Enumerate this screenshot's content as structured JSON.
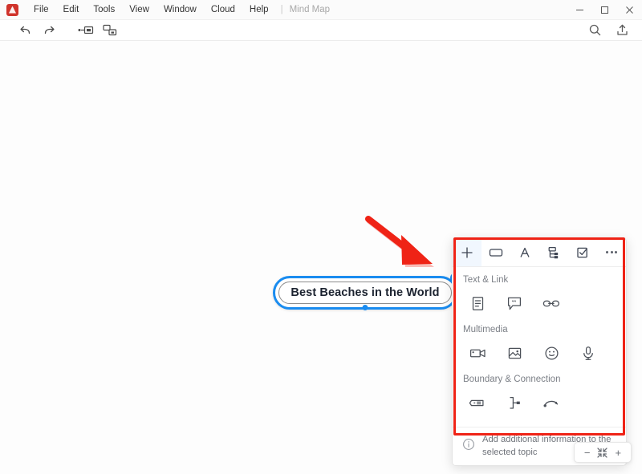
{
  "window": {
    "doc_name": "Mind Map",
    "menu_separator": "|",
    "menus": [
      {
        "label": "File",
        "name": "menu-file"
      },
      {
        "label": "Edit",
        "name": "menu-edit"
      },
      {
        "label": "Tools",
        "name": "menu-tools"
      },
      {
        "label": "View",
        "name": "menu-view"
      },
      {
        "label": "Window",
        "name": "menu-window"
      },
      {
        "label": "Cloud",
        "name": "menu-cloud"
      },
      {
        "label": "Help",
        "name": "menu-help"
      }
    ],
    "controls": {
      "minimize": "minimize-button",
      "maximize": "maximize-button",
      "close": "close-button"
    },
    "logo_icon": "app-logo-icon"
  },
  "toolbar": {
    "undo_icon": "undo-icon",
    "redo_icon": "redo-icon",
    "insert_topic_icon": "insert-topic-icon",
    "insert_subtopic_icon": "insert-subtopic-icon",
    "search_icon": "search-icon",
    "share_icon": "share-icon"
  },
  "mindmap": {
    "topic": {
      "text": "Best Beaches in the World",
      "selected": true,
      "selection_color": "#1a8cf0",
      "handle_bottom": "resize-handle-bottom",
      "handle_topright": "add-topic-handle"
    }
  },
  "panel": {
    "tabs": [
      {
        "label": "",
        "icon": "plus-icon",
        "name": "tab-insert",
        "active": true
      },
      {
        "label": "",
        "icon": "shape-icon",
        "name": "tab-shape",
        "active": false
      },
      {
        "label": "",
        "icon": "font-icon",
        "name": "tab-font",
        "active": false
      },
      {
        "label": "",
        "icon": "structure-icon",
        "name": "tab-structure",
        "active": false
      },
      {
        "label": "",
        "icon": "task-checkbox-icon",
        "name": "tab-task",
        "active": false
      },
      {
        "label": "",
        "icon": "more-options-icon",
        "name": "tab-more",
        "active": false
      }
    ],
    "sections": [
      {
        "title": "Text & Link",
        "name": "section-text-and-link",
        "items": [
          {
            "icon": "notes-icon",
            "name": "insert-notes-button"
          },
          {
            "icon": "comment-icon",
            "name": "insert-comment-button"
          },
          {
            "icon": "hyperlink-icon",
            "name": "insert-hyperlink-button"
          }
        ]
      },
      {
        "title": "Multimedia",
        "name": "section-multimedia",
        "items": [
          {
            "icon": "video-icon",
            "name": "insert-video-button"
          },
          {
            "icon": "image-icon",
            "name": "insert-image-button"
          },
          {
            "icon": "emoji-icon",
            "name": "insert-sticker-button"
          },
          {
            "icon": "microphone-icon",
            "name": "insert-audio-button"
          }
        ]
      },
      {
        "title": "Boundary & Connection",
        "name": "section-boundary-and-connection",
        "items": [
          {
            "icon": "boundary-icon",
            "name": "insert-boundary-button"
          },
          {
            "icon": "summary-icon",
            "name": "insert-summary-button"
          },
          {
            "icon": "relationship-icon",
            "name": "insert-relationship-button"
          }
        ]
      }
    ],
    "tooltip": {
      "icon": "info-icon",
      "text": "Add additional information to the selected topic"
    }
  },
  "annotation": {
    "highlight_color": "#ef2316",
    "box_name": "red-highlight-box",
    "arrow_name": "red-pointer-arrow"
  },
  "zoom_controls": {
    "minus_label": "−",
    "fit_icon": "fit-to-screen-icon",
    "plus_label": "+"
  }
}
